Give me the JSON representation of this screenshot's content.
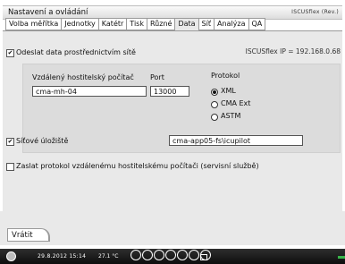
{
  "window": {
    "title": "Nastavení a ovládání",
    "brand": "ISCUSflex (Rev.)"
  },
  "tabs": [
    {
      "label": "Volba měřítka",
      "active": false
    },
    {
      "label": "Jednotky",
      "active": false
    },
    {
      "label": "Katétr",
      "active": false
    },
    {
      "label": "Tisk",
      "active": false
    },
    {
      "label": "Různé",
      "active": false
    },
    {
      "label": "Data",
      "active": true
    },
    {
      "label": "Síť",
      "active": false
    },
    {
      "label": "Analýza",
      "active": false
    },
    {
      "label": "QA",
      "active": false
    }
  ],
  "network": {
    "send_data_label": "Odeslat data prostřednictvím sítě",
    "send_data_checked": true,
    "ip_info": "ISCUSflex IP = 192.168.0.68",
    "remote_computer_label": "Vzdálený hostitelský počítač",
    "remote_computer_value": "cma-mh-04",
    "port_label": "Port",
    "port_value": "13000",
    "protocol_label": "Protokol",
    "protocol_options": [
      "XML",
      "CMA Ext",
      "ASTM"
    ],
    "protocol_selected": "XML"
  },
  "storage": {
    "label": "Síťové úložiště",
    "checked": true,
    "path_value": "cma-app05-fs\\icupilot"
  },
  "send_protocol": {
    "label": "Zaslat protokol vzdálenému hostitelskému počítači (servisní službě)",
    "checked": false
  },
  "back_button": {
    "label": "Vrátit"
  },
  "status": {
    "datetime": "29.8.2012 15:14",
    "temperature": "27.1 °C"
  }
}
